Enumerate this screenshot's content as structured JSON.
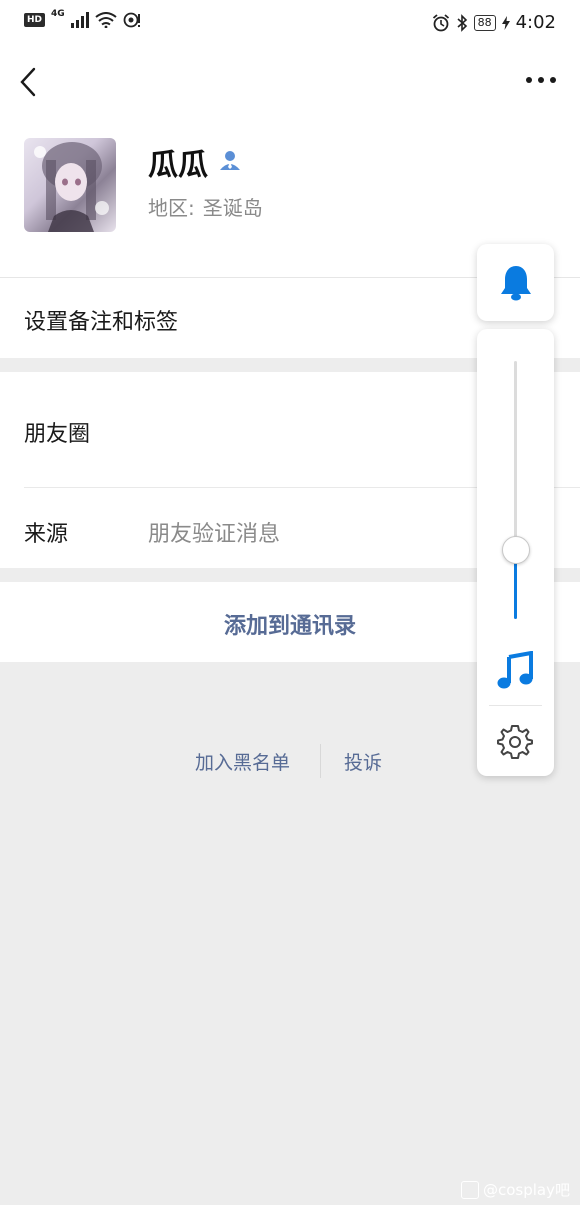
{
  "status_bar": {
    "hd": "HD",
    "network": "4G",
    "battery": "88",
    "time": "4:02"
  },
  "profile": {
    "name": "瓜瓜",
    "region_label": "地区:",
    "region_value": "圣诞岛"
  },
  "rows": {
    "remark_tags": "设置备注和标签",
    "moments": "朋友圈",
    "source_label": "来源",
    "source_value": "朋友验证消息"
  },
  "actions": {
    "add_to_contacts": "添加到通讯录",
    "add_to_blacklist": "加入黑名单",
    "report": "投诉"
  },
  "volume_panel": {
    "level": 0.27,
    "accent_color": "#0a7be0",
    "icons": [
      "bell-icon",
      "music-note-icon",
      "gear-icon"
    ]
  },
  "watermark": "@cosplay吧",
  "colors": {
    "link": "#576b95",
    "background": "#ededed"
  }
}
